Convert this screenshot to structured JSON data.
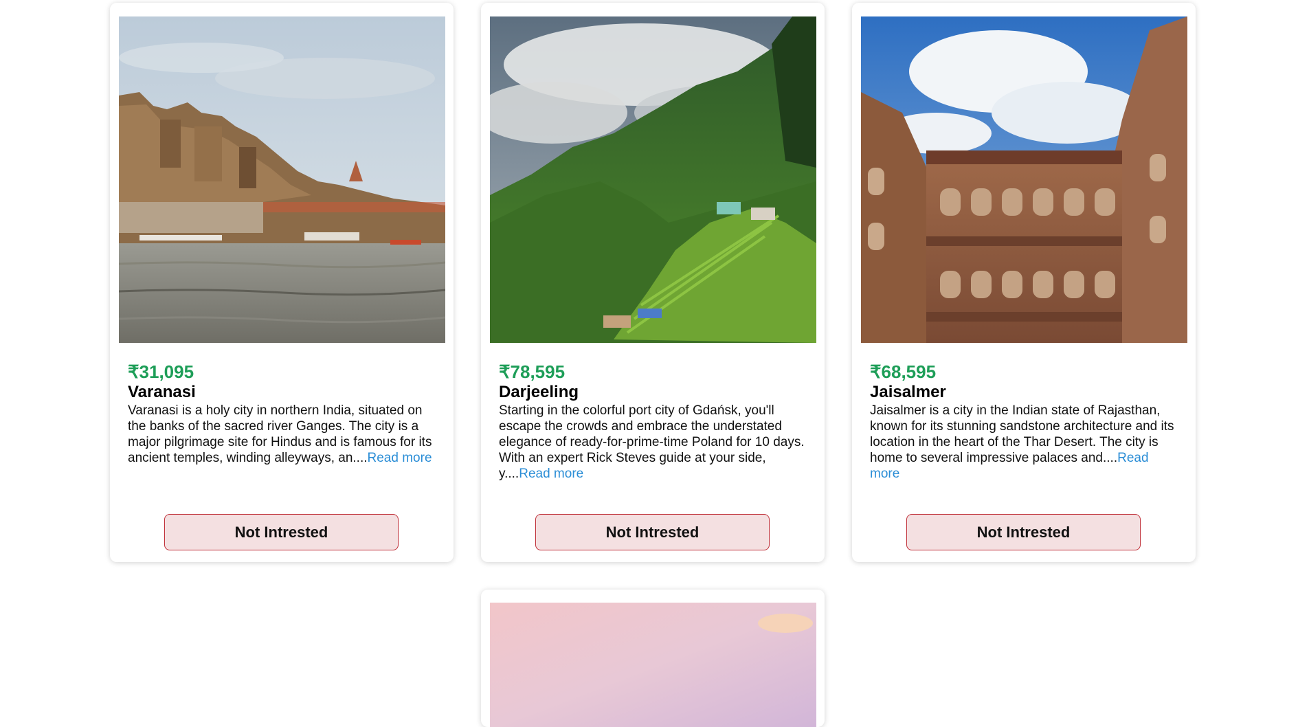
{
  "cards": [
    {
      "price": "₹31,095",
      "name": "Varanasi",
      "description": "Varanasi is a holy city in northern India, situated on the banks of the sacred river Ganges. The city is a major pilgrimage site for Hindus and is famous for its ancient temples, winding alleyways, an....",
      "read_more": "Read more",
      "button": "Not Intrested",
      "image_subject": "river-ghats-photo"
    },
    {
      "price": "₹78,595",
      "name": "Darjeeling",
      "description": "Starting in the colorful port city of Gdańsk, you'll escape the crowds and embrace the understated elegance of ready-for-prime-time Poland for 10 days. With an expert Rick Steves guide at your side, y....",
      "read_more": "Read more",
      "button": "Not Intrested",
      "image_subject": "misty-green-hills-photo"
    },
    {
      "price": "₹68,595",
      "name": "Jaisalmer",
      "description": "Jaisalmer is a city in the Indian state of Rajasthan, known for its stunning sandstone architecture and its location in the heart of the Thar Desert. The city is home to several impressive palaces and....",
      "read_more": "Read more",
      "button": "Not Intrested",
      "image_subject": "sandstone-palace-photo"
    },
    {
      "image_subject": "sunset-sky-photo"
    }
  ],
  "colors": {
    "price": "#1e9e58",
    "link": "#2a8dd6",
    "button_bg": "#f4e0e1",
    "button_border": "#c0313a"
  }
}
